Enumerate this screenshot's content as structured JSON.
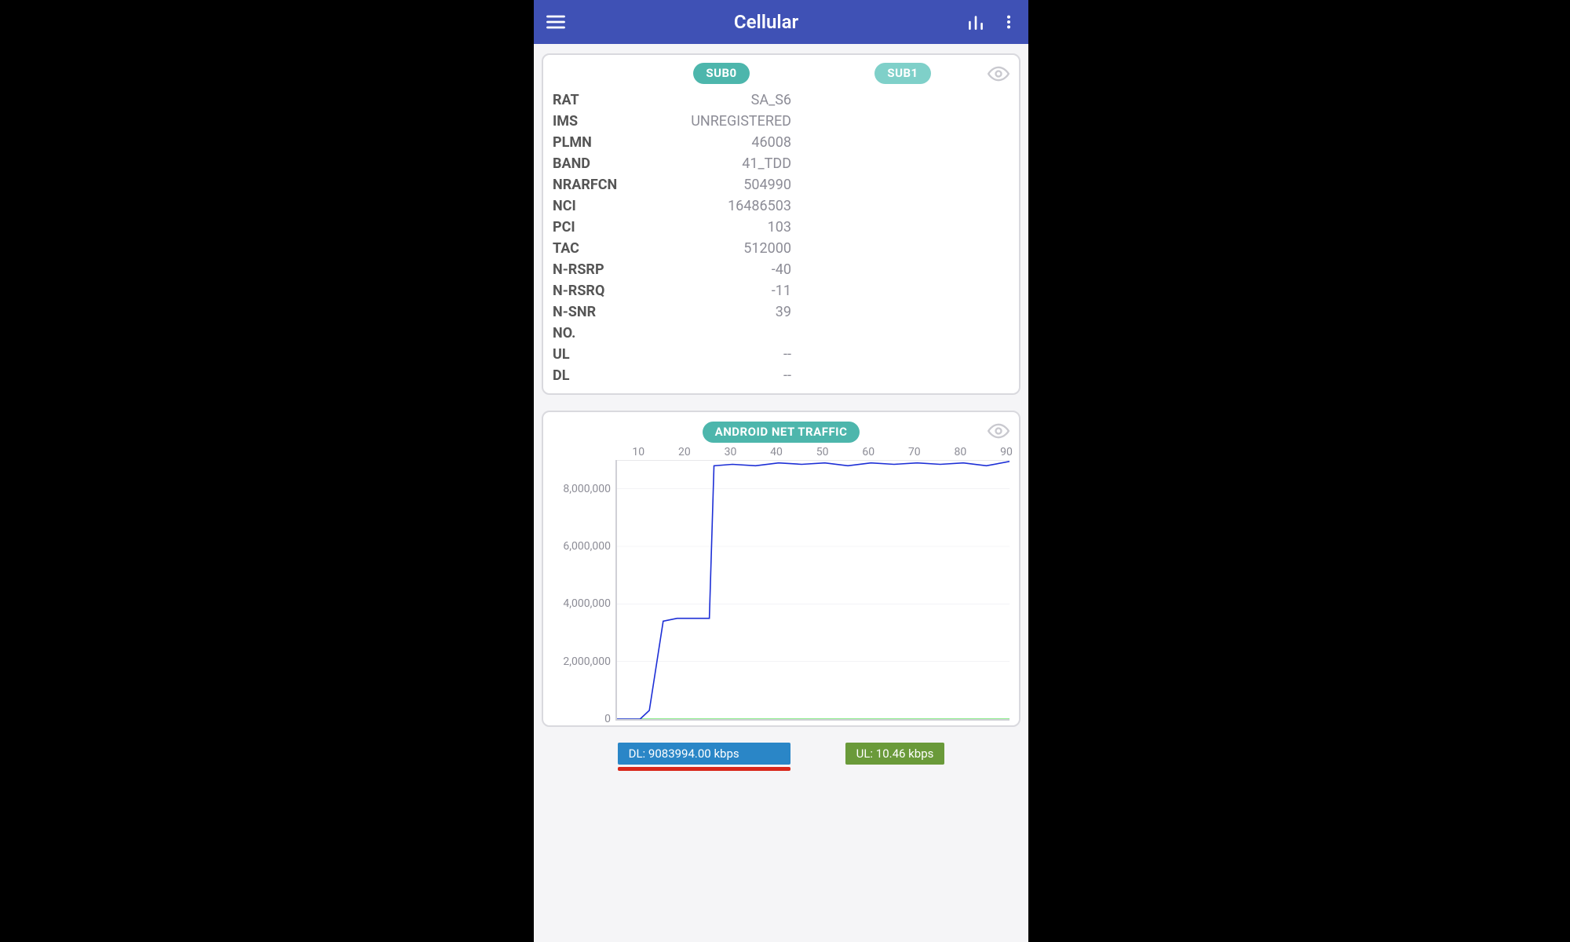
{
  "app": {
    "title": "Cellular"
  },
  "subs": {
    "sub0_label": "SUB0",
    "sub1_label": "SUB1"
  },
  "table": {
    "rows": [
      {
        "k": "RAT",
        "v": "SA_S6"
      },
      {
        "k": "IMS",
        "v": "UNREGISTERED"
      },
      {
        "k": "PLMN",
        "v": "46008"
      },
      {
        "k": "BAND",
        "v": "41_TDD"
      },
      {
        "k": "NRARFCN",
        "v": "504990"
      },
      {
        "k": "NCI",
        "v": "16486503"
      },
      {
        "k": "PCI",
        "v": "103"
      },
      {
        "k": "TAC",
        "v": "512000"
      },
      {
        "k": "N-RSRP",
        "v": "-40"
      },
      {
        "k": "N-RSRQ",
        "v": "-11"
      },
      {
        "k": "N-SNR",
        "v": "39"
      },
      {
        "k": "NO.",
        "v": ""
      },
      {
        "k": "UL",
        "v": "--"
      },
      {
        "k": "DL",
        "v": "--"
      }
    ]
  },
  "traffic": {
    "label": "ANDROID NET TRAFFIC",
    "badge_dl": "DL: 9083994.00 kbps",
    "badge_ul": "UL: 10.46 kbps"
  },
  "chart_data": {
    "type": "line",
    "title": "ANDROID NET TRAFFIC",
    "xlabel": "",
    "ylabel": "",
    "xlim": [
      5,
      90
    ],
    "ylim": [
      0,
      9000000
    ],
    "x_ticks": [
      10,
      20,
      30,
      40,
      50,
      60,
      70,
      80,
      90
    ],
    "y_ticks": [
      0,
      2000000,
      4000000,
      6000000,
      8000000
    ],
    "y_tick_labels": [
      "0",
      "2,000,000",
      "4,000,000",
      "6,000,000",
      "8,000,000"
    ],
    "series": [
      {
        "name": "DL",
        "color": "#1d2fd6",
        "x": [
          5,
          10,
          12,
          15,
          18,
          20,
          25,
          26,
          30,
          35,
          40,
          45,
          50,
          55,
          60,
          65,
          70,
          75,
          80,
          85,
          90
        ],
        "values": [
          0,
          0,
          300000,
          3400000,
          3500000,
          3500000,
          3500000,
          8800000,
          8850000,
          8800000,
          8900000,
          8850000,
          8900000,
          8800000,
          8900000,
          8850000,
          8900000,
          8850000,
          8900000,
          8800000,
          8950000
        ]
      },
      {
        "name": "UL",
        "color": "#4be04b",
        "x": [
          5,
          90
        ],
        "values": [
          10,
          10
        ]
      }
    ]
  }
}
